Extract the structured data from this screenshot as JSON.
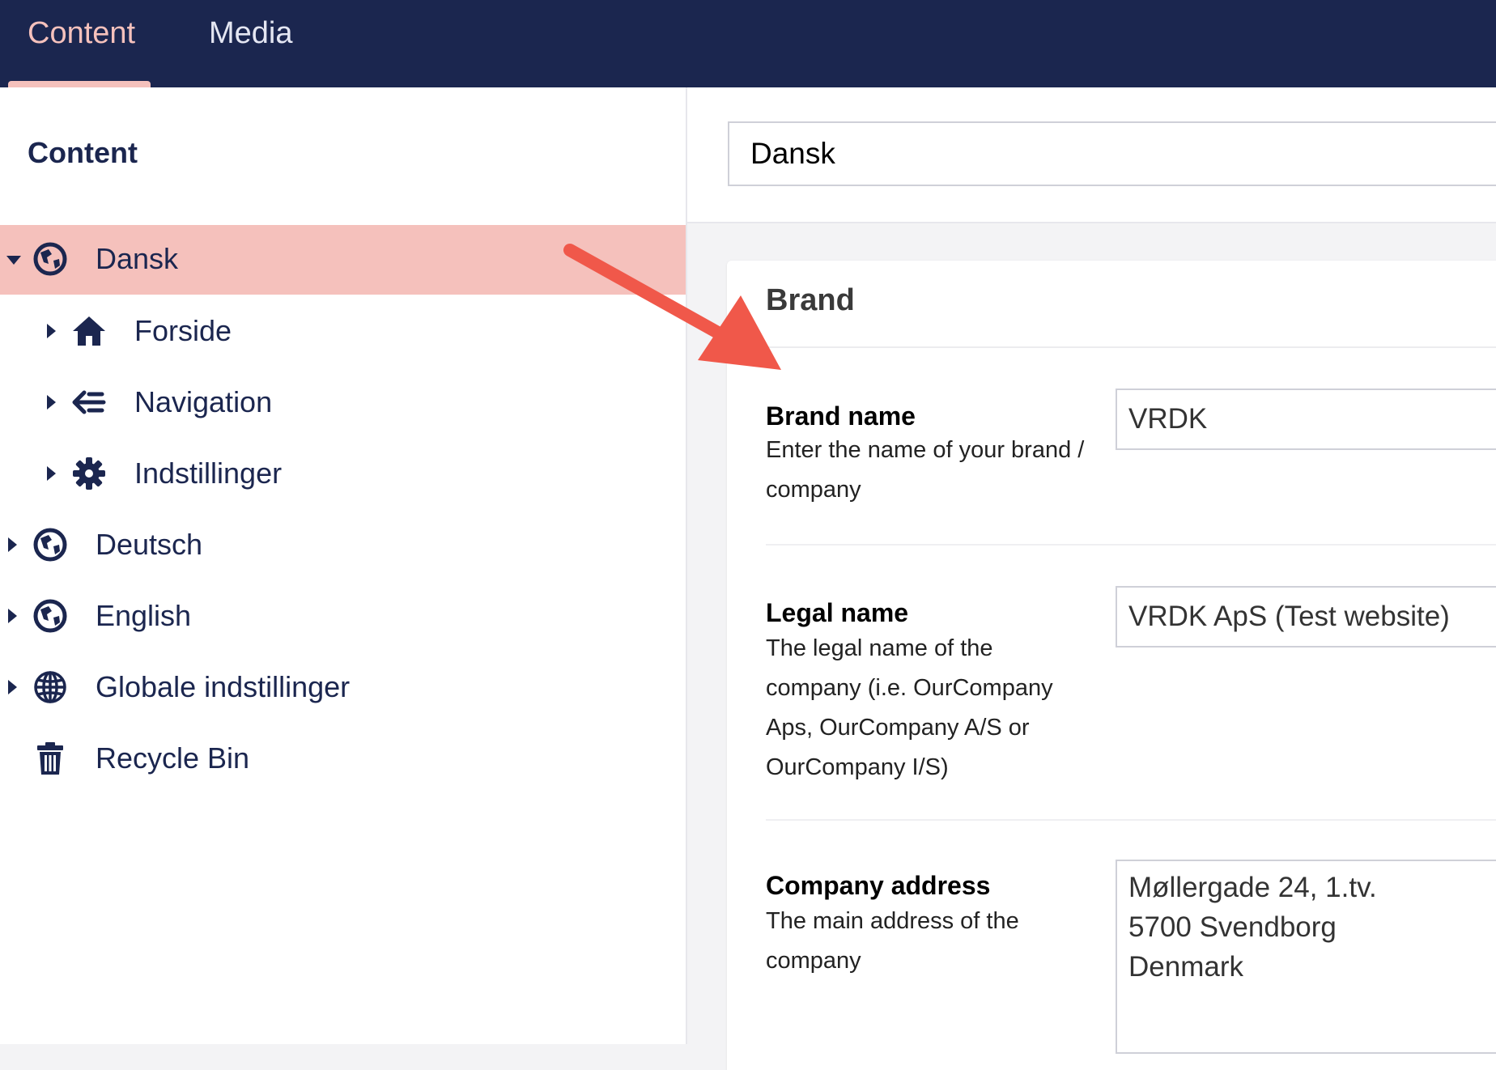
{
  "topnav": {
    "tabs": [
      {
        "label": "Content",
        "active": true
      },
      {
        "label": "Media",
        "active": false
      }
    ]
  },
  "sidebar": {
    "title": "Content",
    "items": [
      {
        "label": "Dansk",
        "icon": "globe-americas-icon",
        "selected": true,
        "expanded": true
      },
      {
        "label": "Forside",
        "icon": "home-icon",
        "child": true
      },
      {
        "label": "Navigation",
        "icon": "navigation-icon",
        "child": true
      },
      {
        "label": "Indstillinger",
        "icon": "gear-icon",
        "child": true
      },
      {
        "label": "Deutsch",
        "icon": "globe-americas-icon"
      },
      {
        "label": "English",
        "icon": "globe-americas-icon"
      },
      {
        "label": "Globale indstillinger",
        "icon": "globe-grid-icon"
      },
      {
        "label": "Recycle Bin",
        "icon": "trash-icon"
      }
    ]
  },
  "editor": {
    "node_name": "Dansk",
    "group_title": "Brand",
    "properties": [
      {
        "label": "Brand name",
        "description": "Enter the name of your brand / company",
        "value": "VRDK"
      },
      {
        "label": "Legal name",
        "description": "The legal name of the company (i.e. OurCompany Aps, OurCompany A/S or OurCompany I/S)",
        "value": "VRDK ApS (Test website)"
      },
      {
        "label": "Company address",
        "description": "The main address of the company",
        "value": "Møllergade 24, 1.tv.\n5700 Svendborg\nDenmark"
      }
    ]
  },
  "colors": {
    "header": "#1b264f",
    "accent": "#f5c1bc",
    "annotation_arrow": "#f0584a"
  }
}
